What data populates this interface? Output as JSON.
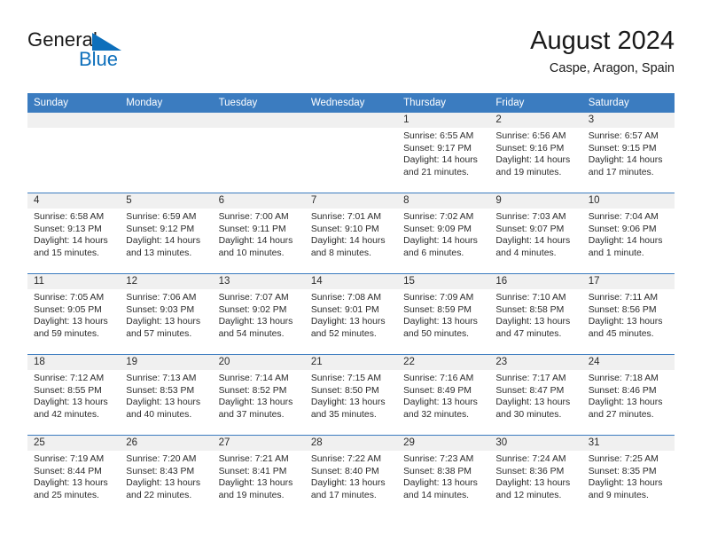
{
  "brand": {
    "name_part1": "General",
    "name_part2": "Blue",
    "mark": "blue-flag-triangle-logo",
    "color_text": "#1a1a1a",
    "color_blue": "#0d6fbb"
  },
  "header": {
    "title": "August 2024",
    "subtitle": "Caspe, Aragon, Spain"
  },
  "theme": {
    "header_bar": "#3b7cc0",
    "day_band": "#f0f0f0",
    "text": "#2b2b2b",
    "page_bg": "#ffffff"
  },
  "weekday_headers": [
    "Sunday",
    "Monday",
    "Tuesday",
    "Wednesday",
    "Thursday",
    "Friday",
    "Saturday"
  ],
  "weeks": [
    [
      {
        "day": "",
        "empty": true,
        "sunrise": "",
        "sunset": "",
        "daylight_line1": "",
        "daylight_line2": ""
      },
      {
        "day": "",
        "empty": true,
        "sunrise": "",
        "sunset": "",
        "daylight_line1": "",
        "daylight_line2": ""
      },
      {
        "day": "",
        "empty": true,
        "sunrise": "",
        "sunset": "",
        "daylight_line1": "",
        "daylight_line2": ""
      },
      {
        "day": "",
        "empty": true,
        "sunrise": "",
        "sunset": "",
        "daylight_line1": "",
        "daylight_line2": ""
      },
      {
        "day": "1",
        "empty": false,
        "sunrise": "Sunrise: 6:55 AM",
        "sunset": "Sunset: 9:17 PM",
        "daylight_line1": "Daylight: 14 hours",
        "daylight_line2": "and 21 minutes."
      },
      {
        "day": "2",
        "empty": false,
        "sunrise": "Sunrise: 6:56 AM",
        "sunset": "Sunset: 9:16 PM",
        "daylight_line1": "Daylight: 14 hours",
        "daylight_line2": "and 19 minutes."
      },
      {
        "day": "3",
        "empty": false,
        "sunrise": "Sunrise: 6:57 AM",
        "sunset": "Sunset: 9:15 PM",
        "daylight_line1": "Daylight: 14 hours",
        "daylight_line2": "and 17 minutes."
      }
    ],
    [
      {
        "day": "4",
        "empty": false,
        "sunrise": "Sunrise: 6:58 AM",
        "sunset": "Sunset: 9:13 PM",
        "daylight_line1": "Daylight: 14 hours",
        "daylight_line2": "and 15 minutes."
      },
      {
        "day": "5",
        "empty": false,
        "sunrise": "Sunrise: 6:59 AM",
        "sunset": "Sunset: 9:12 PM",
        "daylight_line1": "Daylight: 14 hours",
        "daylight_line2": "and 13 minutes."
      },
      {
        "day": "6",
        "empty": false,
        "sunrise": "Sunrise: 7:00 AM",
        "sunset": "Sunset: 9:11 PM",
        "daylight_line1": "Daylight: 14 hours",
        "daylight_line2": "and 10 minutes."
      },
      {
        "day": "7",
        "empty": false,
        "sunrise": "Sunrise: 7:01 AM",
        "sunset": "Sunset: 9:10 PM",
        "daylight_line1": "Daylight: 14 hours",
        "daylight_line2": "and 8 minutes."
      },
      {
        "day": "8",
        "empty": false,
        "sunrise": "Sunrise: 7:02 AM",
        "sunset": "Sunset: 9:09 PM",
        "daylight_line1": "Daylight: 14 hours",
        "daylight_line2": "and 6 minutes."
      },
      {
        "day": "9",
        "empty": false,
        "sunrise": "Sunrise: 7:03 AM",
        "sunset": "Sunset: 9:07 PM",
        "daylight_line1": "Daylight: 14 hours",
        "daylight_line2": "and 4 minutes."
      },
      {
        "day": "10",
        "empty": false,
        "sunrise": "Sunrise: 7:04 AM",
        "sunset": "Sunset: 9:06 PM",
        "daylight_line1": "Daylight: 14 hours",
        "daylight_line2": "and 1 minute."
      }
    ],
    [
      {
        "day": "11",
        "empty": false,
        "sunrise": "Sunrise: 7:05 AM",
        "sunset": "Sunset: 9:05 PM",
        "daylight_line1": "Daylight: 13 hours",
        "daylight_line2": "and 59 minutes."
      },
      {
        "day": "12",
        "empty": false,
        "sunrise": "Sunrise: 7:06 AM",
        "sunset": "Sunset: 9:03 PM",
        "daylight_line1": "Daylight: 13 hours",
        "daylight_line2": "and 57 minutes."
      },
      {
        "day": "13",
        "empty": false,
        "sunrise": "Sunrise: 7:07 AM",
        "sunset": "Sunset: 9:02 PM",
        "daylight_line1": "Daylight: 13 hours",
        "daylight_line2": "and 54 minutes."
      },
      {
        "day": "14",
        "empty": false,
        "sunrise": "Sunrise: 7:08 AM",
        "sunset": "Sunset: 9:01 PM",
        "daylight_line1": "Daylight: 13 hours",
        "daylight_line2": "and 52 minutes."
      },
      {
        "day": "15",
        "empty": false,
        "sunrise": "Sunrise: 7:09 AM",
        "sunset": "Sunset: 8:59 PM",
        "daylight_line1": "Daylight: 13 hours",
        "daylight_line2": "and 50 minutes."
      },
      {
        "day": "16",
        "empty": false,
        "sunrise": "Sunrise: 7:10 AM",
        "sunset": "Sunset: 8:58 PM",
        "daylight_line1": "Daylight: 13 hours",
        "daylight_line2": "and 47 minutes."
      },
      {
        "day": "17",
        "empty": false,
        "sunrise": "Sunrise: 7:11 AM",
        "sunset": "Sunset: 8:56 PM",
        "daylight_line1": "Daylight: 13 hours",
        "daylight_line2": "and 45 minutes."
      }
    ],
    [
      {
        "day": "18",
        "empty": false,
        "sunrise": "Sunrise: 7:12 AM",
        "sunset": "Sunset: 8:55 PM",
        "daylight_line1": "Daylight: 13 hours",
        "daylight_line2": "and 42 minutes."
      },
      {
        "day": "19",
        "empty": false,
        "sunrise": "Sunrise: 7:13 AM",
        "sunset": "Sunset: 8:53 PM",
        "daylight_line1": "Daylight: 13 hours",
        "daylight_line2": "and 40 minutes."
      },
      {
        "day": "20",
        "empty": false,
        "sunrise": "Sunrise: 7:14 AM",
        "sunset": "Sunset: 8:52 PM",
        "daylight_line1": "Daylight: 13 hours",
        "daylight_line2": "and 37 minutes."
      },
      {
        "day": "21",
        "empty": false,
        "sunrise": "Sunrise: 7:15 AM",
        "sunset": "Sunset: 8:50 PM",
        "daylight_line1": "Daylight: 13 hours",
        "daylight_line2": "and 35 minutes."
      },
      {
        "day": "22",
        "empty": false,
        "sunrise": "Sunrise: 7:16 AM",
        "sunset": "Sunset: 8:49 PM",
        "daylight_line1": "Daylight: 13 hours",
        "daylight_line2": "and 32 minutes."
      },
      {
        "day": "23",
        "empty": false,
        "sunrise": "Sunrise: 7:17 AM",
        "sunset": "Sunset: 8:47 PM",
        "daylight_line1": "Daylight: 13 hours",
        "daylight_line2": "and 30 minutes."
      },
      {
        "day": "24",
        "empty": false,
        "sunrise": "Sunrise: 7:18 AM",
        "sunset": "Sunset: 8:46 PM",
        "daylight_line1": "Daylight: 13 hours",
        "daylight_line2": "and 27 minutes."
      }
    ],
    [
      {
        "day": "25",
        "empty": false,
        "sunrise": "Sunrise: 7:19 AM",
        "sunset": "Sunset: 8:44 PM",
        "daylight_line1": "Daylight: 13 hours",
        "daylight_line2": "and 25 minutes."
      },
      {
        "day": "26",
        "empty": false,
        "sunrise": "Sunrise: 7:20 AM",
        "sunset": "Sunset: 8:43 PM",
        "daylight_line1": "Daylight: 13 hours",
        "daylight_line2": "and 22 minutes."
      },
      {
        "day": "27",
        "empty": false,
        "sunrise": "Sunrise: 7:21 AM",
        "sunset": "Sunset: 8:41 PM",
        "daylight_line1": "Daylight: 13 hours",
        "daylight_line2": "and 19 minutes."
      },
      {
        "day": "28",
        "empty": false,
        "sunrise": "Sunrise: 7:22 AM",
        "sunset": "Sunset: 8:40 PM",
        "daylight_line1": "Daylight: 13 hours",
        "daylight_line2": "and 17 minutes."
      },
      {
        "day": "29",
        "empty": false,
        "sunrise": "Sunrise: 7:23 AM",
        "sunset": "Sunset: 8:38 PM",
        "daylight_line1": "Daylight: 13 hours",
        "daylight_line2": "and 14 minutes."
      },
      {
        "day": "30",
        "empty": false,
        "sunrise": "Sunrise: 7:24 AM",
        "sunset": "Sunset: 8:36 PM",
        "daylight_line1": "Daylight: 13 hours",
        "daylight_line2": "and 12 minutes."
      },
      {
        "day": "31",
        "empty": false,
        "sunrise": "Sunrise: 7:25 AM",
        "sunset": "Sunset: 8:35 PM",
        "daylight_line1": "Daylight: 13 hours",
        "daylight_line2": "and 9 minutes."
      }
    ]
  ]
}
